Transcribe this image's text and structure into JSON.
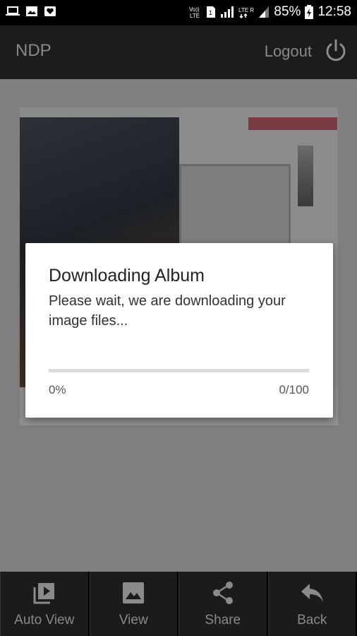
{
  "status_bar": {
    "left_icons": [
      "laptop-icon",
      "image-icon",
      "heart-icon"
    ],
    "right_icons": [
      "volte-icon",
      "sim-icon",
      "signal-icon",
      "lte-icon",
      "signal2-icon",
      "battery-icon"
    ],
    "battery": "85%",
    "time": "12:58"
  },
  "app_bar": {
    "title": "NDP",
    "logout_label": "Logout",
    "power_icon": "power-icon"
  },
  "dialog": {
    "title": "Downloading Album",
    "message": "Please wait, we are downloading your image files...",
    "progress_percent": "0%",
    "progress_count": "0/100",
    "progress_value": 0
  },
  "bottom_nav": {
    "items": [
      {
        "label": "Auto View",
        "icon": "auto-view-icon"
      },
      {
        "label": "View",
        "icon": "image-icon"
      },
      {
        "label": "Share",
        "icon": "share-icon"
      },
      {
        "label": "Back",
        "icon": "back-arrow-icon"
      }
    ]
  },
  "colors": {
    "accent": "#4caf50",
    "overlay": "#7f7f7f",
    "bar": "#1c1c1c"
  }
}
